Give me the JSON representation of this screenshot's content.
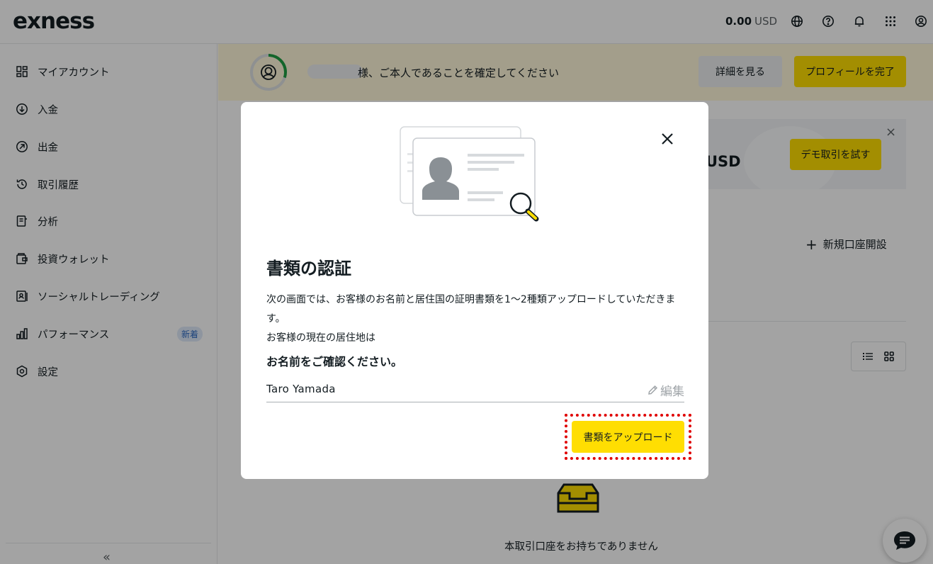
{
  "header": {
    "logo": "exness",
    "balance_amount": "0.00",
    "balance_currency": "USD",
    "icons": [
      "globe-icon",
      "help-icon",
      "bell-icon",
      "apps-grid-icon",
      "profile-icon"
    ]
  },
  "sidebar": {
    "items": [
      {
        "label": "マイアカウント",
        "icon": "dashboard-icon"
      },
      {
        "label": "入金",
        "icon": "deposit-icon"
      },
      {
        "label": "出金",
        "icon": "withdrawal-icon"
      },
      {
        "label": "取引履歴",
        "icon": "history-icon"
      },
      {
        "label": "分析",
        "icon": "analytics-icon"
      },
      {
        "label": "投資ウォレット",
        "icon": "wallet-icon"
      },
      {
        "label": "ソーシャルトレーディング",
        "icon": "social-trading-icon"
      },
      {
        "label": "パフォーマンス",
        "icon": "performance-icon",
        "badge": "新着"
      },
      {
        "label": "設定",
        "icon": "settings-icon"
      }
    ],
    "collapse_label": "«"
  },
  "banner": {
    "text": "様、ご本人であることを確定してください",
    "details_button": "詳細を見る",
    "complete_button": "プロフィールを完了",
    "progress": 0.3
  },
  "demo_card": {
    "currency": "USD",
    "button": "デモ取引を試す",
    "close": "×"
  },
  "accounts": {
    "new_account_label": "新規口座開設",
    "empty_text": "本取引口座をお持ちでありません"
  },
  "modal": {
    "title": "書類の認証",
    "description_line1": "次の画面では、お客様のお名前と居住国の証明書類を1～2種類アップロードしていただきます。",
    "description_line2": "お客様の現在の居住地は",
    "confirm_label": "お名前をご確認ください。",
    "name_value": "Taro Yamada",
    "edit_label": "編集",
    "upload_button": "書類をアップロード"
  },
  "colors": {
    "accent_yellow": "#ffde02",
    "banner_bg": "#fff7d9",
    "highlight_red": "#e00000",
    "progress_green": "#1e9e43"
  }
}
